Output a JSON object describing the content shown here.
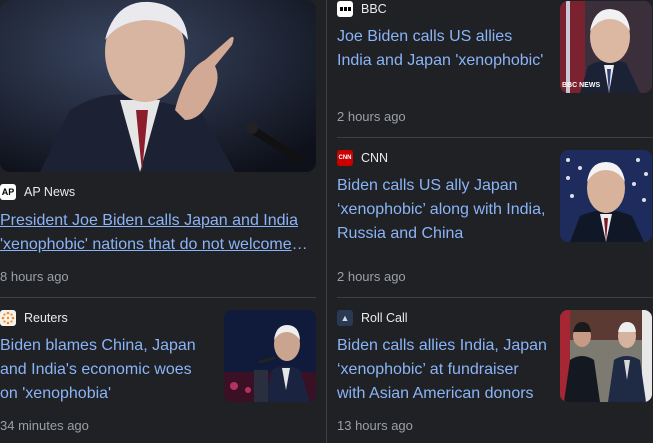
{
  "hero": {
    "source": "AP News",
    "logo_text": "AP",
    "headline": "President Joe Biden calls Japan and India 'xenophobic' nations that do not welcome immigrants",
    "time": "8 hours ago"
  },
  "cards": [
    {
      "source": "BBC",
      "headline": "Joe Biden calls US allies India and Japan 'xenophobic'",
      "time": "2 hours ago",
      "thumb_caption": "BBC NEWS"
    },
    {
      "source": "CNN",
      "logo_text": "CNN",
      "headline": "Biden calls US ally Japan ‘xenophobic’ along with India, Russia and China",
      "time": "2 hours ago"
    },
    {
      "source": "Reuters",
      "headline": "Biden blames China, Japan and India's economic woes on 'xenophobia'",
      "time": "34 minutes ago"
    },
    {
      "source": "Roll Call",
      "logo_text": "▲",
      "headline": "Biden calls allies India, Japan ‘xenophobic’ at fundraiser with Asian American donors",
      "time": "13 hours ago"
    }
  ],
  "colors": {
    "background": "#202124",
    "headline": "#8ab4f8",
    "meta": "#9aa0a6",
    "divider": "#3c4043"
  }
}
